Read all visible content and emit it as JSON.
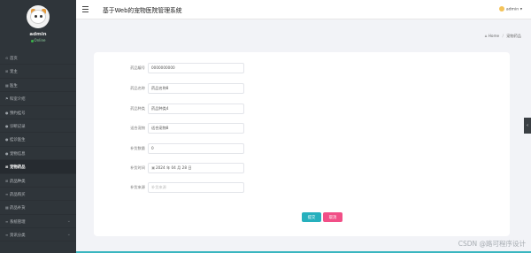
{
  "profile": {
    "name": "admin",
    "status": "Online"
  },
  "sidebar": {
    "items": [
      {
        "icon": "⊙",
        "label": "首页",
        "active": false,
        "chevron": false
      },
      {
        "icon": "⊞",
        "label": "宠主",
        "active": false,
        "chevron": false
      },
      {
        "icon": "▦",
        "label": "医生",
        "active": false,
        "chevron": false
      },
      {
        "icon": "⚑",
        "label": "科室介绍",
        "active": false,
        "chevron": false
      },
      {
        "icon": "●",
        "label": "预约挂号",
        "active": false,
        "chevron": false
      },
      {
        "icon": "●",
        "label": "诊断记录",
        "active": false,
        "chevron": false
      },
      {
        "icon": "●",
        "label": "挂诊医生",
        "active": false,
        "chevron": false
      },
      {
        "icon": "●",
        "label": "宠物信息",
        "active": false,
        "chevron": false
      },
      {
        "icon": "⊞",
        "label": "宠物药品",
        "active": true,
        "chevron": false
      },
      {
        "icon": "⊞",
        "label": "药品种类",
        "active": false,
        "chevron": false
      },
      {
        "icon": "≡",
        "label": "药品购买",
        "active": false,
        "chevron": false
      },
      {
        "icon": "▦",
        "label": "药品补货",
        "active": false,
        "chevron": false
      },
      {
        "icon": "≡",
        "label": "系统管理",
        "active": false,
        "chevron": true
      },
      {
        "icon": "≡",
        "label": "资讯分类",
        "active": false,
        "chevron": true
      }
    ]
  },
  "topbar": {
    "title": "基于Web的宠物医院管理系统",
    "user": "admin"
  },
  "breadcrumb": {
    "home": "Home",
    "current": "宠物药品"
  },
  "form": {
    "fields": [
      {
        "label": "药品编号",
        "value": "0000000000",
        "placeholder": false
      },
      {
        "label": "药品名称",
        "value": "药品名称8",
        "placeholder": false
      },
      {
        "label": "药品种类",
        "value": "药品种类4",
        "placeholder": false
      },
      {
        "label": "适合宠物",
        "value": "适合宠物8",
        "placeholder": false
      },
      {
        "label": "补货数量",
        "value": "0",
        "placeholder": false
      },
      {
        "label": "补货时间",
        "value": "2024 年 04 月 28 日",
        "placeholder": false,
        "calendar": true
      },
      {
        "label": "补货来源",
        "value": "补货来源",
        "placeholder": true
      }
    ],
    "submit_label": "提交",
    "cancel_label": "取消"
  },
  "watermark": "CSDN @路可程序设计",
  "colors": {
    "sidebar": "#2f353a",
    "submit": "#26b0bd",
    "cancel": "#f14f87",
    "page_bg": "#f2f3f7"
  }
}
